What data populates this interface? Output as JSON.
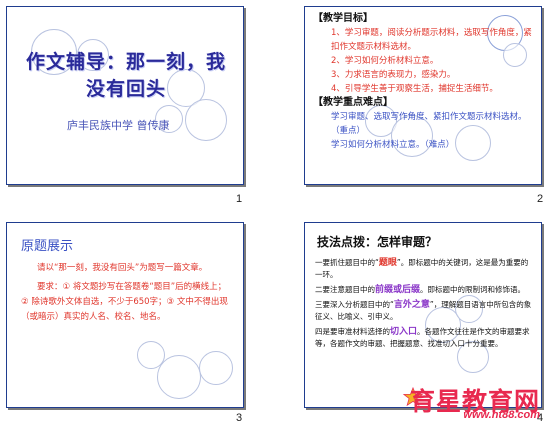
{
  "slides": [
    {
      "number": "1",
      "title": "作文辅导：那一刻，我没有回头",
      "subtitle": "庐丰民族中学   曾传康"
    },
    {
      "number": "2",
      "goal_heading": "【教学目标】",
      "goals": [
        "1、学习审题，阅读分析题示材料，选取写作角度，紧扣作文题示材料选材。",
        "2、学习如何分析材料立意。",
        "3、力求语言的表现力，感染力。",
        "4、引导学生善于观察生活，捕捉生活细节。"
      ],
      "key_heading": "【教学重点难点】",
      "key_points": [
        "学习审题、选取写作角度、紧扣作文题示材料选材。（重点）",
        "学习如何分析材料立意。（难点）"
      ]
    },
    {
      "number": "3",
      "title": "原题展示",
      "para1": "请以“那一刻，我没有回头”为题写一篇文章。",
      "para1_bold": "“那一刻，我没有回头”",
      "para2": "要求：① 将文题抄写在答题卷“题目”后的横线上；② 除诗歌外文体自选，不少于650字；③ 文中不得出现（或暗示）真实的人名、校名、地名。"
    },
    {
      "number": "4",
      "title": "技法点拨：怎样审题？",
      "steps": [
        {
          "pre": "一要抓住题目中的“",
          "hl": "题眼",
          "post": "”。即标题中的关键词，这是最为重要的一环。",
          "hl_color": "red"
        },
        {
          "pre": "二要注意题目中的",
          "hl": "前缀或后缀",
          "post": "。即标题中的限制词和修饰语。",
          "hl_color": "purple"
        },
        {
          "pre": "三要深入分析题目中的“",
          "hl": "言外之意",
          "post": "”，理解题目语言中所包含的象征义、比喻义、引申义。",
          "hl_color": "purple"
        },
        {
          "pre": "四是要审准材料选择的",
          "hl": "切入口",
          "post": "。各题作文往往是作文的审题要求等，各题作文的审题、把握题意、找准切入口十分重要。",
          "hl_color": "purple"
        }
      ]
    }
  ],
  "watermark": {
    "text": "育星教育网",
    "url": "www.ht88.com"
  },
  "colors": {
    "title_blue": "#2a2a9a",
    "accent_red": "#e0362c",
    "accent_purple": "#8a36c8",
    "watermark_red": "#e8294f"
  }
}
